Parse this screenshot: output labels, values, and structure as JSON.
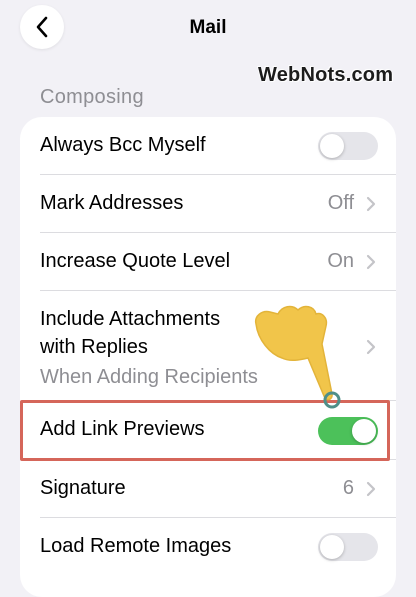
{
  "nav": {
    "title": "Mail",
    "back_icon": "chevron-left-icon"
  },
  "watermark": "WebNots.com",
  "section": {
    "header": "Composing",
    "rows": [
      {
        "label": "Always Bcc Myself",
        "control": "toggle",
        "toggle_on": false
      },
      {
        "label": "Mark Addresses",
        "control": "disclosure",
        "value": "Off"
      },
      {
        "label": "Increase Quote Level",
        "control": "disclosure",
        "value": "On"
      },
      {
        "label_line1": "Include Attachments",
        "label_line2": "with Replies",
        "sublabel": "When Adding Recipients",
        "control": "disclosure"
      },
      {
        "label": "Add Link Previews",
        "control": "toggle",
        "toggle_on": true
      },
      {
        "label": "Signature",
        "control": "disclosure",
        "value": "6"
      },
      {
        "label": "Load Remote Images",
        "control": "toggle",
        "toggle_on": false
      }
    ]
  },
  "colors": {
    "background": "#f2f1f6",
    "toggle_on": "#4cc15a",
    "highlight_border": "#d5665a",
    "pointer_hand": "#f1c54a"
  }
}
